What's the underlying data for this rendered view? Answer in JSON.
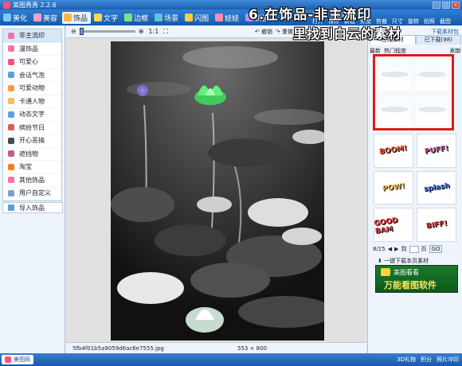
{
  "window": {
    "title": "美图秀秀 2.2.6"
  },
  "menu_tabs": [
    {
      "label": "美化",
      "color": "#7ec9ff"
    },
    {
      "label": "美容",
      "color": "#ff9ec4"
    },
    {
      "label": "饰品",
      "color": "#ffb347"
    },
    {
      "label": "文字",
      "color": "#ffd84d"
    },
    {
      "label": "边框",
      "color": "#7fe07f"
    },
    {
      "label": "场景",
      "color": "#5ec8c8"
    },
    {
      "label": "闪图",
      "color": "#ffcd3c"
    },
    {
      "label": "娃娃",
      "color": "#ff8ab4"
    },
    {
      "label": "拼图",
      "color": "#b58cff"
    }
  ],
  "active_tab": "饰品",
  "header_right_menu": [
    "菜单",
    "提意见"
  ],
  "header_tools": [
    "打开",
    "保存",
    "新建",
    "预览",
    "剪裁",
    "尺寸",
    "旋转",
    "拍照",
    "截图"
  ],
  "annotations": {
    "line1": "6.在饰品-非主流印",
    "line2": "里找到白云的素材"
  },
  "left_panel": {
    "categories": [
      {
        "label": "非主流印",
        "color": "#ff6fa0"
      },
      {
        "label": "漫饰品",
        "color": "#ff6fa0"
      },
      {
        "label": "可爱心",
        "color": "#ff4f7e"
      },
      {
        "label": "会话气泡",
        "color": "#5aa0e0"
      },
      {
        "label": "可爱动物",
        "color": "#ff9a3c"
      },
      {
        "label": "卡通人物",
        "color": "#ffbb55"
      },
      {
        "label": "动态文字",
        "color": "#5aa0e0"
      },
      {
        "label": "缤纷节日",
        "color": "#e05a5a"
      },
      {
        "label": "开心恶搞",
        "color": "#4a4a4a"
      },
      {
        "label": "遮挡物",
        "color": "#c85a8a"
      },
      {
        "label": "淘宝",
        "color": "#ff7a1c"
      },
      {
        "label": "其他饰品",
        "color": "#ff6fa0"
      },
      {
        "label": "用户自定义",
        "color": "#7aa0d0"
      }
    ],
    "import_label": "导入饰品"
  },
  "toolbar": {
    "zoom_ratio": "1:1",
    "undo_label": "撤销",
    "redo_label": "重做"
  },
  "canvas": {
    "filename": "5fb4f01b5a9059d6ac6e7555.jpg",
    "dimensions": "553 × 800"
  },
  "right_panel": {
    "tabs": [
      "在线素材",
      "已下载(98)"
    ],
    "download_link": "下载素材包",
    "filter_labels": [
      "最新",
      "热门程度"
    ],
    "refresh_label": "刷新",
    "stickers": [
      "BOOM!",
      "PUFF!",
      "POW!",
      "splash",
      "GOOD BAM",
      "BIFF!"
    ],
    "pager": {
      "current": "8/25",
      "to_label": "到",
      "page_label": "页",
      "go_label": "GO"
    },
    "download_all_label": "一键下载本页素材",
    "ad": {
      "line1": "美图看看",
      "line2": "万能看图软件"
    }
  },
  "taskbar": {
    "start_label": "美图网",
    "tray": [
      "3D礼物",
      "积分",
      "照片冲印"
    ]
  }
}
